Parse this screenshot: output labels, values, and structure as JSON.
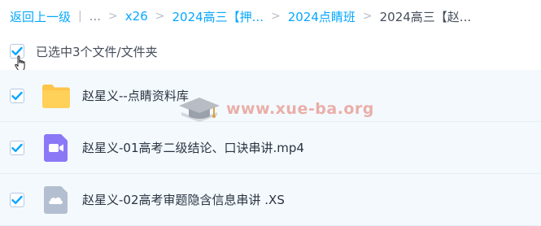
{
  "breadcrumb": {
    "back": "返回上一级",
    "dots": "...",
    "items": [
      {
        "label": "x26"
      },
      {
        "label": "2024高三【押..."
      },
      {
        "label": "2024点睛班"
      }
    ],
    "current": "2024高三【赵..."
  },
  "selection": {
    "text": "已选中3个文件/文件夹"
  },
  "files": [
    {
      "name": "赵星义--点睛资料库",
      "icon": "folder-icon"
    },
    {
      "name": "赵星义-01高考二级结论、口诀串讲.mp4",
      "icon": "video-file-icon"
    },
    {
      "name": "赵星义-02高考审题隐含信息串讲 .XS",
      "icon": "cloud-file-icon"
    }
  ],
  "watermark": {
    "text": "www.xue-ba.org"
  },
  "colors": {
    "accent": "#06a7ff",
    "row_background": "#f4f9fe",
    "folder": "#fdc54a",
    "video": "#8a78f6",
    "cloud_file": "#b3bfd1",
    "watermark": "#e8a79f"
  }
}
